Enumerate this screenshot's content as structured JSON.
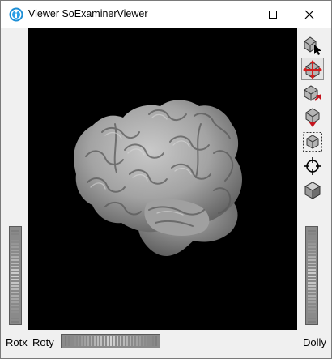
{
  "window": {
    "title": "Viewer SoExaminerViewer"
  },
  "titlebar": {
    "minimize_icon": "minimize-icon",
    "maximize_icon": "maximize-icon",
    "close_icon": "close-icon"
  },
  "viewer": {
    "background_color": "#000000",
    "model": "3D surface render of a human brain (grey)",
    "model_color": "#a6a6a6"
  },
  "toolbar": {
    "buttons": [
      {
        "name": "pick-mode",
        "icon": "arrow-pointer-icon",
        "active": false
      },
      {
        "name": "view-mode",
        "icon": "rotate-hand-icon",
        "active": true
      },
      {
        "name": "home",
        "icon": "home-icon",
        "active": false
      },
      {
        "name": "set-home",
        "icon": "set-home-icon",
        "active": false
      },
      {
        "name": "view-all",
        "icon": "view-all-icon",
        "active": false
      },
      {
        "name": "seek",
        "icon": "crosshair-icon",
        "active": false
      },
      {
        "name": "projection",
        "icon": "cube-icon",
        "active": false
      }
    ]
  },
  "wheels": {
    "rotx_label": "Rotx",
    "roty_label": "Roty",
    "dolly_label": "Dolly"
  }
}
